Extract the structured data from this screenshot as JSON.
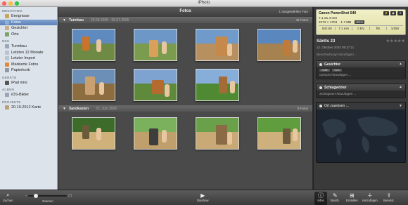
{
  "window": {
    "title": "iPhoto"
  },
  "sidebar": {
    "sections": [
      {
        "label": "MEDIATHEK",
        "items": [
          {
            "label": "Ereignisse",
            "icon": "events-icon",
            "color": "#c9a45b"
          },
          {
            "label": "Fotos",
            "icon": "photos-icon",
            "color": "#8db0d8",
            "selected": true
          },
          {
            "label": "Gesichter",
            "icon": "faces-icon",
            "color": "#c8b08a"
          },
          {
            "label": "Orte",
            "icon": "places-icon",
            "color": "#7aa46b"
          }
        ]
      },
      {
        "label": "NEU",
        "items": [
          {
            "label": "Turmbau",
            "icon": "event-icon",
            "color": "#9aa6b5"
          },
          {
            "label": "Letzten 12 Monate",
            "icon": "calendar-icon",
            "color": "#b9c4d0"
          },
          {
            "label": "Letzter Import",
            "icon": "import-icon",
            "color": "#b9c4d0"
          },
          {
            "label": "Markierte Fotos",
            "icon": "flag-icon",
            "color": "#e08a3c"
          },
          {
            "label": "Papierkorb",
            "icon": "trash-icon",
            "color": "#8f9aa6"
          }
        ]
      },
      {
        "label": "GERÄTE",
        "items": [
          {
            "label": "iPad mini",
            "icon": "ipad-icon",
            "color": "#555555"
          }
        ]
      },
      {
        "label": "ALBEN",
        "items": [
          {
            "label": "iOS-Bilder",
            "icon": "album-icon",
            "color": "#9aa6b5"
          }
        ]
      },
      {
        "label": "PROJEKTE",
        "items": [
          {
            "label": "20.10.2012 Karte",
            "icon": "card-icon",
            "color": "#b8a27a"
          }
        ]
      }
    ]
  },
  "main": {
    "title": "Fotos",
    "selection_count": "1 ausgewähltes Foto",
    "events": [
      {
        "name": "Turmbau",
        "date": "26.05.2005 - 06.07.2005",
        "count": "45 Fotos",
        "photos": [
          {
            "sky": "#5f8ac0",
            "ground": "#6f8a45",
            "obj": "#c9742a"
          },
          {
            "sky": "#6d97c7",
            "ground": "#7b9c4e",
            "obj": "#d9a05b"
          },
          {
            "sky": "#6f9ac9",
            "ground": "#b79060",
            "obj": "#c58a4b"
          },
          {
            "sky": "#5a87bd",
            "ground": "#a5824f",
            "obj": "#c07a3a"
          },
          {
            "sky": "#6c8fb8",
            "ground": "#8c6d3f",
            "obj": "#c9a070"
          },
          {
            "sky": "#7ea3d0",
            "ground": "#5f8a3c",
            "obj": "#b56a2f"
          },
          {
            "sky": "#86aed8",
            "ground": "#4f8a32",
            "obj": "#a36b35"
          }
        ]
      },
      {
        "name": "Sandkasten",
        "date": "23. Juni 2005",
        "count": "8 Fotos",
        "photos": [
          {
            "sky": "#3d6b2a",
            "ground": "#cfb27a",
            "obj": "#6c5b3a"
          },
          {
            "sky": "#7bb05c",
            "ground": "#bfa06c",
            "obj": "#3d3d3d"
          },
          {
            "sky": "#6aa04a",
            "ground": "#c9aa77",
            "obj": "#8a6b45"
          },
          {
            "sky": "#5f9d3e",
            "ground": "#cdb07c",
            "obj": "#6b5a3e"
          }
        ]
      }
    ]
  },
  "info": {
    "camera": "Canon PowerShot S40",
    "aperture": "7.1-21.3 mm",
    "dimensions": "2272 × 1704",
    "filesize": "1.7 MB",
    "format": "JPEG",
    "exif": [
      "ISO 50",
      "7.1 mm",
      "0 EV",
      "f/8",
      "1/250"
    ],
    "photo_title": "Säntis 23",
    "photo_date": "12. Oktober 2003 09:37:11",
    "description_placeholder": "Beschreibung hinzufügen ...",
    "faces_header": "Gesichter",
    "faces": [
      "Judith",
      "Sven"
    ],
    "faces_add": "Gesicht hinzufügen ...",
    "keywords_header": "Schlagwörter",
    "keywords_add": "Schlagwort hinzufügen ...",
    "map_header": "Ort zuweisen ..."
  },
  "toolbar": {
    "search": "Suchen",
    "zoom": "Zoomen",
    "slideshow": "Diashow",
    "info": "Infos",
    "edit": "Bearb.",
    "create": "Erstellen",
    "add": "Hinzufügen",
    "share": "Bereitst."
  }
}
